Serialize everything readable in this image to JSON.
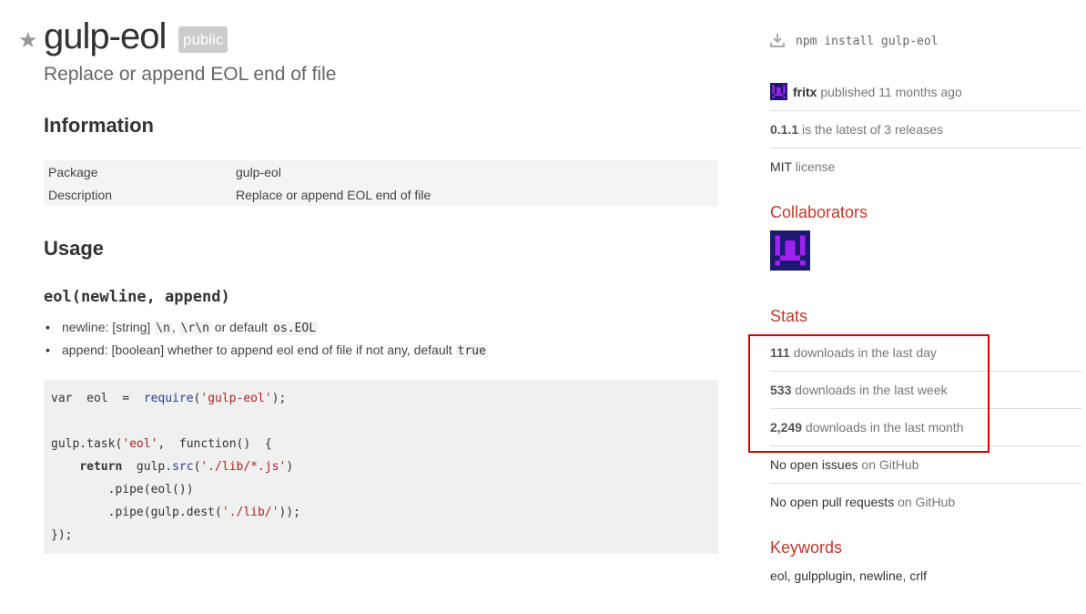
{
  "package": {
    "name": "gulp-eol",
    "visibility": "public",
    "description": "Replace or append EOL end of file"
  },
  "information": {
    "heading": "Information",
    "rows": [
      {
        "key": "Package",
        "value": "gulp-eol"
      },
      {
        "key": "Description",
        "value": "Replace or append EOL end of file"
      }
    ]
  },
  "usage": {
    "heading": "Usage",
    "signature": "eol(newline, append)",
    "params": [
      {
        "prefix": "newline: [string] ",
        "code1": "\\n",
        "sep": ", ",
        "code2": "\\r\\n",
        "suffix": " or default ",
        "code3": "os.EOL"
      },
      {
        "prefix": "append: [boolean] whether to append eol end of file if not any, default ",
        "code1": "true"
      }
    ],
    "code": {
      "l1_a": "var  eol  =  ",
      "l1_fn": "require",
      "l1_b": "(",
      "l1_str": "'gulp-eol'",
      "l1_c": ");",
      "l3_a": "gulp.task(",
      "l3_str": "'eol'",
      "l3_b": ",  function()  {",
      "l4_kw": "return",
      "l4_a": "  gulp.",
      "l4_fn": "src",
      "l4_b": "(",
      "l4_str": "'./lib/*.js'",
      "l4_c": ")",
      "l5": "        .pipe(eol())",
      "l6_a": "        .pipe(gulp.dest(",
      "l6_str": "'./lib/'",
      "l6_b": "));",
      "l7": "});"
    }
  },
  "sidebar": {
    "install_cmd": "npm install gulp-eol",
    "publisher": "fritx",
    "published_text": " published 11 months ago",
    "version": "0.1.1",
    "version_text": " is the latest of 3 releases",
    "license": "MIT",
    "license_text": " license",
    "collaborators_heading": "Collaborators",
    "stats_heading": "Stats",
    "stats": [
      {
        "count": "111",
        "label": " downloads in the last day"
      },
      {
        "count": "533",
        "label": " downloads in the last week"
      },
      {
        "count": "2,249",
        "label": " downloads in the last month"
      }
    ],
    "issues": {
      "bold": "No open issues",
      "link": " on GitHub"
    },
    "pulls": {
      "bold": "No open pull requests",
      "link": " on GitHub"
    },
    "keywords_heading": "Keywords",
    "keywords": "eol, gulpplugin, newline, crlf"
  },
  "colors": {
    "accent": "#c0392b",
    "highlight": "#d40000",
    "avatar": "#a020f0"
  }
}
